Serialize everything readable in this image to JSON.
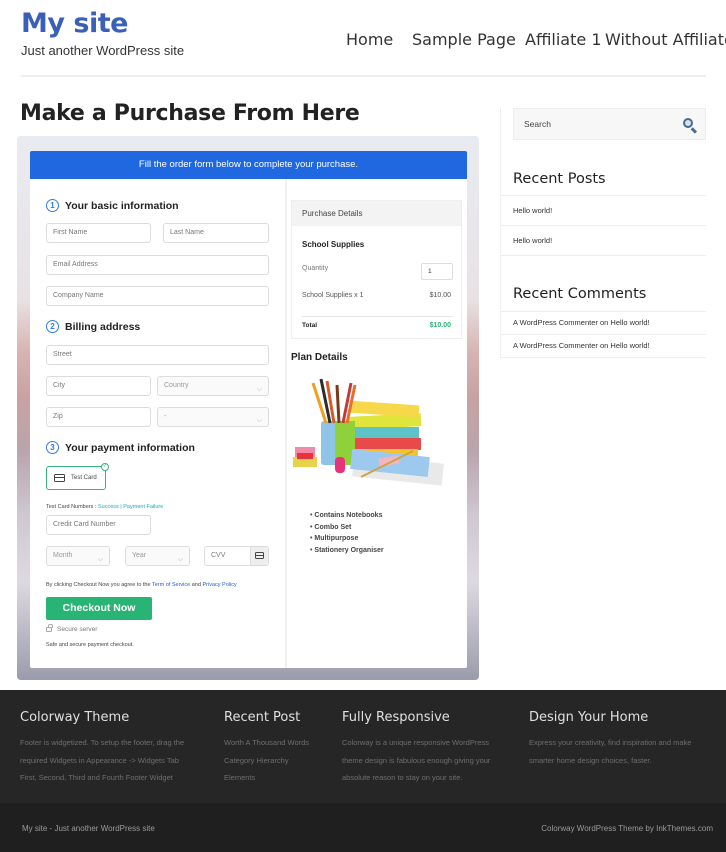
{
  "header": {
    "site_title": "My site",
    "tagline": "Just another WordPress site",
    "nav": [
      {
        "label": "Home"
      },
      {
        "label": "Sample Page"
      },
      {
        "label": "Affiliate 1"
      },
      {
        "label": "Without Affiliate"
      }
    ]
  },
  "main": {
    "page_title": "Make a Purchase From Here",
    "form": {
      "banner": "Fill the order form below to complete your purchase.",
      "steps": [
        {
          "number": "1",
          "title": "Your basic information"
        },
        {
          "number": "2",
          "title": "Billing address"
        },
        {
          "number": "3",
          "title": "Your payment information"
        }
      ],
      "fields": {
        "first_name": "First Name",
        "last_name": "Last Name",
        "email": "Email Address",
        "company": "Company Name",
        "street": "Street",
        "city": "City",
        "country": "Country",
        "zip": "Zip",
        "state": "-",
        "card_number": "Credit Card Number",
        "month": "Month",
        "year": "Year",
        "cvv": "CVV"
      },
      "payment_method": "Test Card",
      "test_card_label": "Test Card Numbers :",
      "test_success": "Success",
      "test_separator": "|",
      "test_failure": "Payment Failure",
      "terms_prefix": "By clicking Checkout Now you agree to the",
      "terms_link": "Term of Service",
      "terms_and": "and",
      "privacy_link": "Privacy Policy",
      "checkout_label": "Checkout Now",
      "secure_server": "Secure server",
      "secure_note": "Safe and secure payment checkout."
    },
    "purchase": {
      "heading": "Purchase Details",
      "product": "School Supplies",
      "quantity_label": "Quantity",
      "quantity_value": "1",
      "line_item": "School Supplies x 1",
      "line_price": "$10.00",
      "total_label": "Total",
      "total_value": "$10.00",
      "total_color": "#28b474"
    },
    "plan": {
      "title": "Plan Details",
      "features": [
        "Contains Notebooks",
        "Combo Set",
        "Multipurpose",
        "Stationery Organiser"
      ]
    }
  },
  "sidebar": {
    "search_placeholder": "Search",
    "recent_posts_title": "Recent Posts",
    "recent_posts": [
      "Hello world!",
      "Hello world!"
    ],
    "recent_comments_title": "Recent Comments",
    "recent_comments": [
      "A WordPress Commenter on Hello world!",
      "A WordPress Commenter on Hello world!"
    ]
  },
  "footer": {
    "columns": [
      {
        "title": "Colorway Theme",
        "lines": [
          "Footer is widgetized. To setup the footer, drag the",
          "required Widgets in Appearance -> Widgets Tab",
          "First, Second, Third and Fourth Footer Widget"
        ]
      },
      {
        "title": "Recent Post",
        "lines": [
          "Worth A Thousand Words",
          "Category Hierarchy",
          "Elements"
        ]
      },
      {
        "title": "Fully Responsive",
        "lines": [
          "Colorway is a unique responsive WordPress",
          "theme design is fabulous enough giving your",
          "absolute reason to stay on your site."
        ]
      },
      {
        "title": "Design Your Home",
        "lines": [
          "Express your creativity, find inspiration and make",
          "smarter home design choices, faster."
        ]
      }
    ],
    "bottom_left": "My site - Just another WordPress site",
    "bottom_right": "Colorway WordPress Theme by InkThemes.com"
  }
}
